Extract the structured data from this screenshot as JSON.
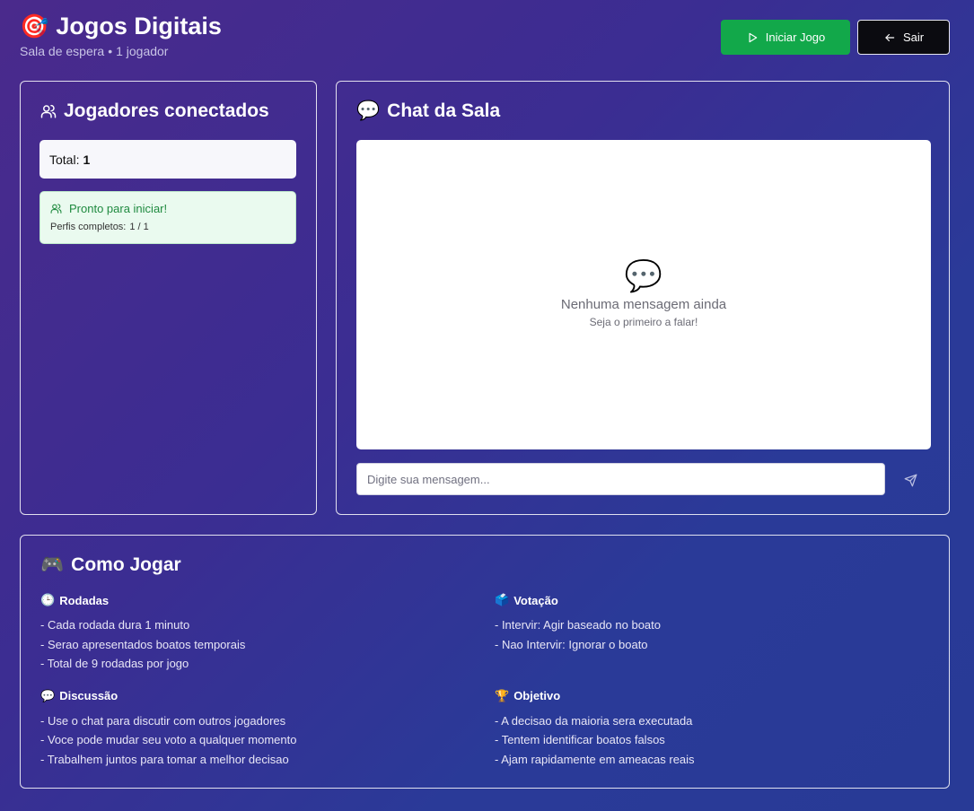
{
  "header": {
    "title_emoji": "🎯",
    "title": "Jogos Digitais",
    "subtitle_room": "Sala de espera",
    "subtitle_sep": "•",
    "subtitle_players": "1 jogador",
    "start_button": "Iniciar Jogo",
    "exit_button": "Sair"
  },
  "players_panel": {
    "title": "Jogadores conectados",
    "total_label": "Total:",
    "total_value": "1",
    "ready_text": "Pronto para iniciar!",
    "profiles_label": "Perfis completos:",
    "profiles_value": "1 / 1"
  },
  "chat_panel": {
    "title_emoji": "💬",
    "title": "Chat da Sala",
    "empty_icon": "💬",
    "empty_title": "Nenhuma mensagem ainda",
    "empty_subtitle": "Seja o primeiro a falar!",
    "input_placeholder": "Digite sua mensagem...",
    "input_value": ""
  },
  "howto_panel": {
    "title_emoji": "🎮",
    "title": "Como Jogar",
    "sections": [
      {
        "emoji": "🕒",
        "title": "Rodadas",
        "items": [
          "- Cada rodada dura 1 minuto",
          "- Serao apresentados boatos temporais",
          "- Total de 9 rodadas por jogo"
        ]
      },
      {
        "emoji": "🗳️",
        "title": "Votação",
        "items": [
          "- Intervir: Agir baseado no boato",
          "- Nao Intervir: Ignorar o boato"
        ]
      },
      {
        "emoji": "💬",
        "title": "Discussão",
        "items": [
          "- Use o chat para discutir com outros jogadores",
          "- Voce pode mudar seu voto a qualquer momento",
          "- Trabalhem juntos para tomar a melhor decisao"
        ]
      },
      {
        "emoji": "🏆",
        "title": "Objetivo",
        "items": [
          "- A decisao da maioria sera executada",
          "- Tentem identificar boatos falsos",
          "- Ajam rapidamente em ameacas reais"
        ]
      }
    ]
  },
  "colors": {
    "start_button": "#12a84a",
    "exit_button": "#0b0b10",
    "ready_text": "#1f8a3f",
    "background_start": "#4a2a8c",
    "background_end": "#283a96"
  },
  "icons": {
    "title": "target-icon",
    "start": "play-icon",
    "exit": "arrow-left-icon",
    "players": "users-icon",
    "ready": "users-icon",
    "chat": "speech-bubble-icon",
    "send": "send-icon"
  }
}
